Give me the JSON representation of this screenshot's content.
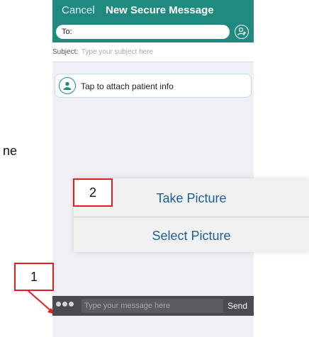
{
  "background_text": "ne",
  "header": {
    "cancel_label": "Cancel",
    "title": "New Secure Message",
    "to_placeholder": "To:",
    "add_recipient_icon": "add-person-icon"
  },
  "subject": {
    "label": "Subject:",
    "placeholder": "Type your subject here"
  },
  "attach": {
    "icon": "patient-icon",
    "label": "Tap to attach patient info"
  },
  "action_sheet": {
    "items": [
      {
        "label": "Take Picture"
      },
      {
        "label": "Select Picture"
      }
    ]
  },
  "annotations": {
    "marker_1": "1",
    "marker_2": "2",
    "arrow_color": "#e11f1f"
  },
  "compose": {
    "more_icon": "more-dots-icon",
    "placeholder": "Type your message here",
    "send_label": "Send"
  },
  "colors": {
    "header": "#1f8a80",
    "action_text": "#1f5f97",
    "compose_bar": "#4b4b4f"
  }
}
